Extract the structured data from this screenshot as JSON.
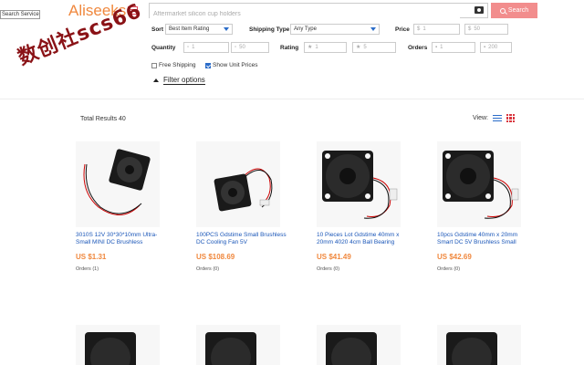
{
  "search_service": "Search Service",
  "watermark": "数创社scs66",
  "logo": "Aliseeks",
  "search": {
    "placeholder": "Aftermarket silicon cup holders",
    "button": "Search"
  },
  "filters": {
    "sort_label": "Sort",
    "sort_value": "Best Item Rating",
    "shipping_label": "Shipping Type",
    "shipping_value": "Any Type",
    "price_label": "Price",
    "price_min": "1",
    "price_max": "50",
    "currency": "$",
    "quantity_label": "Quantity",
    "quantity_min": "1",
    "quantity_max": "50",
    "rating_label": "Rating",
    "rating_min": "1",
    "rating_max": "5",
    "orders_label": "Orders",
    "orders_min": "1",
    "orders_max": "200",
    "free_shipping": "Free Shipping",
    "show_unit_prices": "Show Unit Prices",
    "free_shipping_checked": false,
    "show_unit_prices_checked": true,
    "filter_options": "Filter options"
  },
  "results": {
    "total": "Total Results 40",
    "view_label": "View:"
  },
  "products": [
    {
      "title": "3010S 12V 30*30*10mm Ultra-Small MINI DC Brushless",
      "price": "US $1.31",
      "orders": "Orders (1)"
    },
    {
      "title": "100PCS Gdstime Small Brushless DC Cooling Fan 5V",
      "price": "US $108.69",
      "orders": "Orders (0)"
    },
    {
      "title": "10 Pieces Lot Gdstime 40mm x 20mm 4020 4cm Ball Bearing",
      "price": "US $41.49",
      "orders": "Orders (0)"
    },
    {
      "title": "10pcs Gdstime 40mm x 20mm Smart DC 5V Brushless Small",
      "price": "US $42.69",
      "orders": "Orders (0)"
    }
  ],
  "colors": {
    "accent": "#f0883e",
    "link": "#1a56b8",
    "search_button": "#f28d8d",
    "grid_icon": "#d9363e"
  }
}
